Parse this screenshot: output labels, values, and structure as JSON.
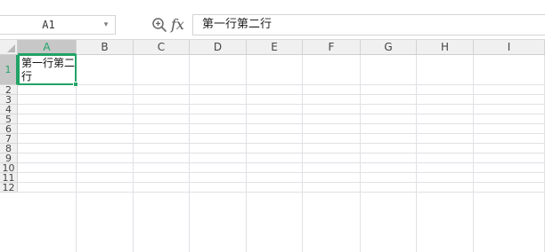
{
  "name_box": {
    "value": "A1",
    "arrow": "▾"
  },
  "formula_bar": {
    "fx": "fx",
    "content": "第一行第二行"
  },
  "columns": [
    "A",
    "B",
    "C",
    "D",
    "E",
    "F",
    "G",
    "H",
    "I"
  ],
  "rows": [
    "1",
    "2",
    "3",
    "4",
    "5",
    "6",
    "7",
    "8",
    "9",
    "10",
    "11",
    "12"
  ],
  "active_cell": {
    "ref": "A1",
    "text": "第一行第二行"
  },
  "colors": {
    "accent": "#21a366",
    "header_bg": "#f0f0f0",
    "grid": "#e1e1e6"
  }
}
